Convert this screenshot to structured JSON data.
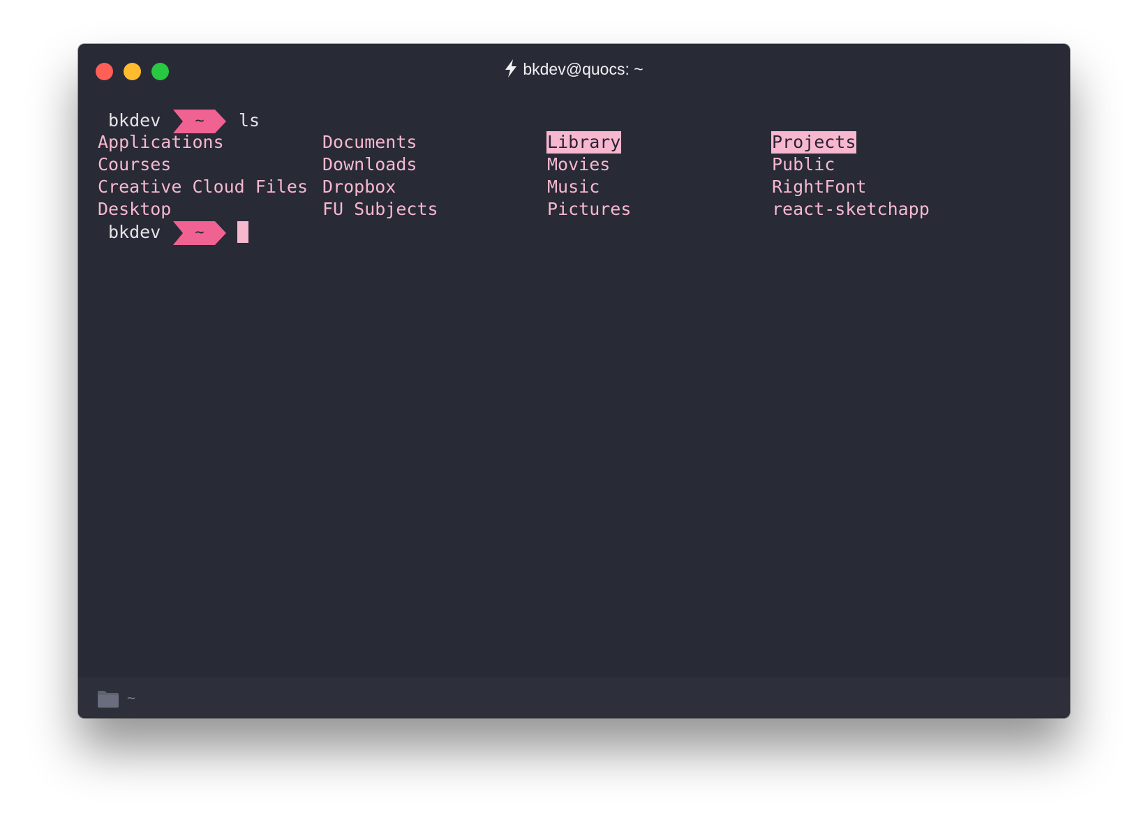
{
  "window": {
    "title": "bkdev@quocs: ~",
    "title_icon": "lightning-bolt-icon"
  },
  "colors": {
    "background": "#282a36",
    "prompt_accent": "#f06292",
    "file_text": "#f7b8cf",
    "status_bar": "#2d2f3b"
  },
  "terminal": {
    "prompt1": {
      "user": "bkdev",
      "dir": "~",
      "command": "ls"
    },
    "listing": {
      "columns": [
        [
          "Applications",
          "Courses",
          "Creative Cloud Files",
          "Desktop"
        ],
        [
          "Documents",
          "Downloads",
          "Dropbox",
          "FU Subjects"
        ],
        [
          "Library",
          "Movies",
          "Music",
          "Pictures"
        ],
        [
          "Projects",
          "Public",
          "RightFont",
          "react-sketchapp"
        ]
      ],
      "highlighted": [
        "Library",
        "Projects"
      ]
    },
    "prompt2": {
      "user": "bkdev",
      "dir": "~",
      "command": ""
    }
  },
  "status_bar": {
    "icon": "folder-icon",
    "path": "~"
  }
}
